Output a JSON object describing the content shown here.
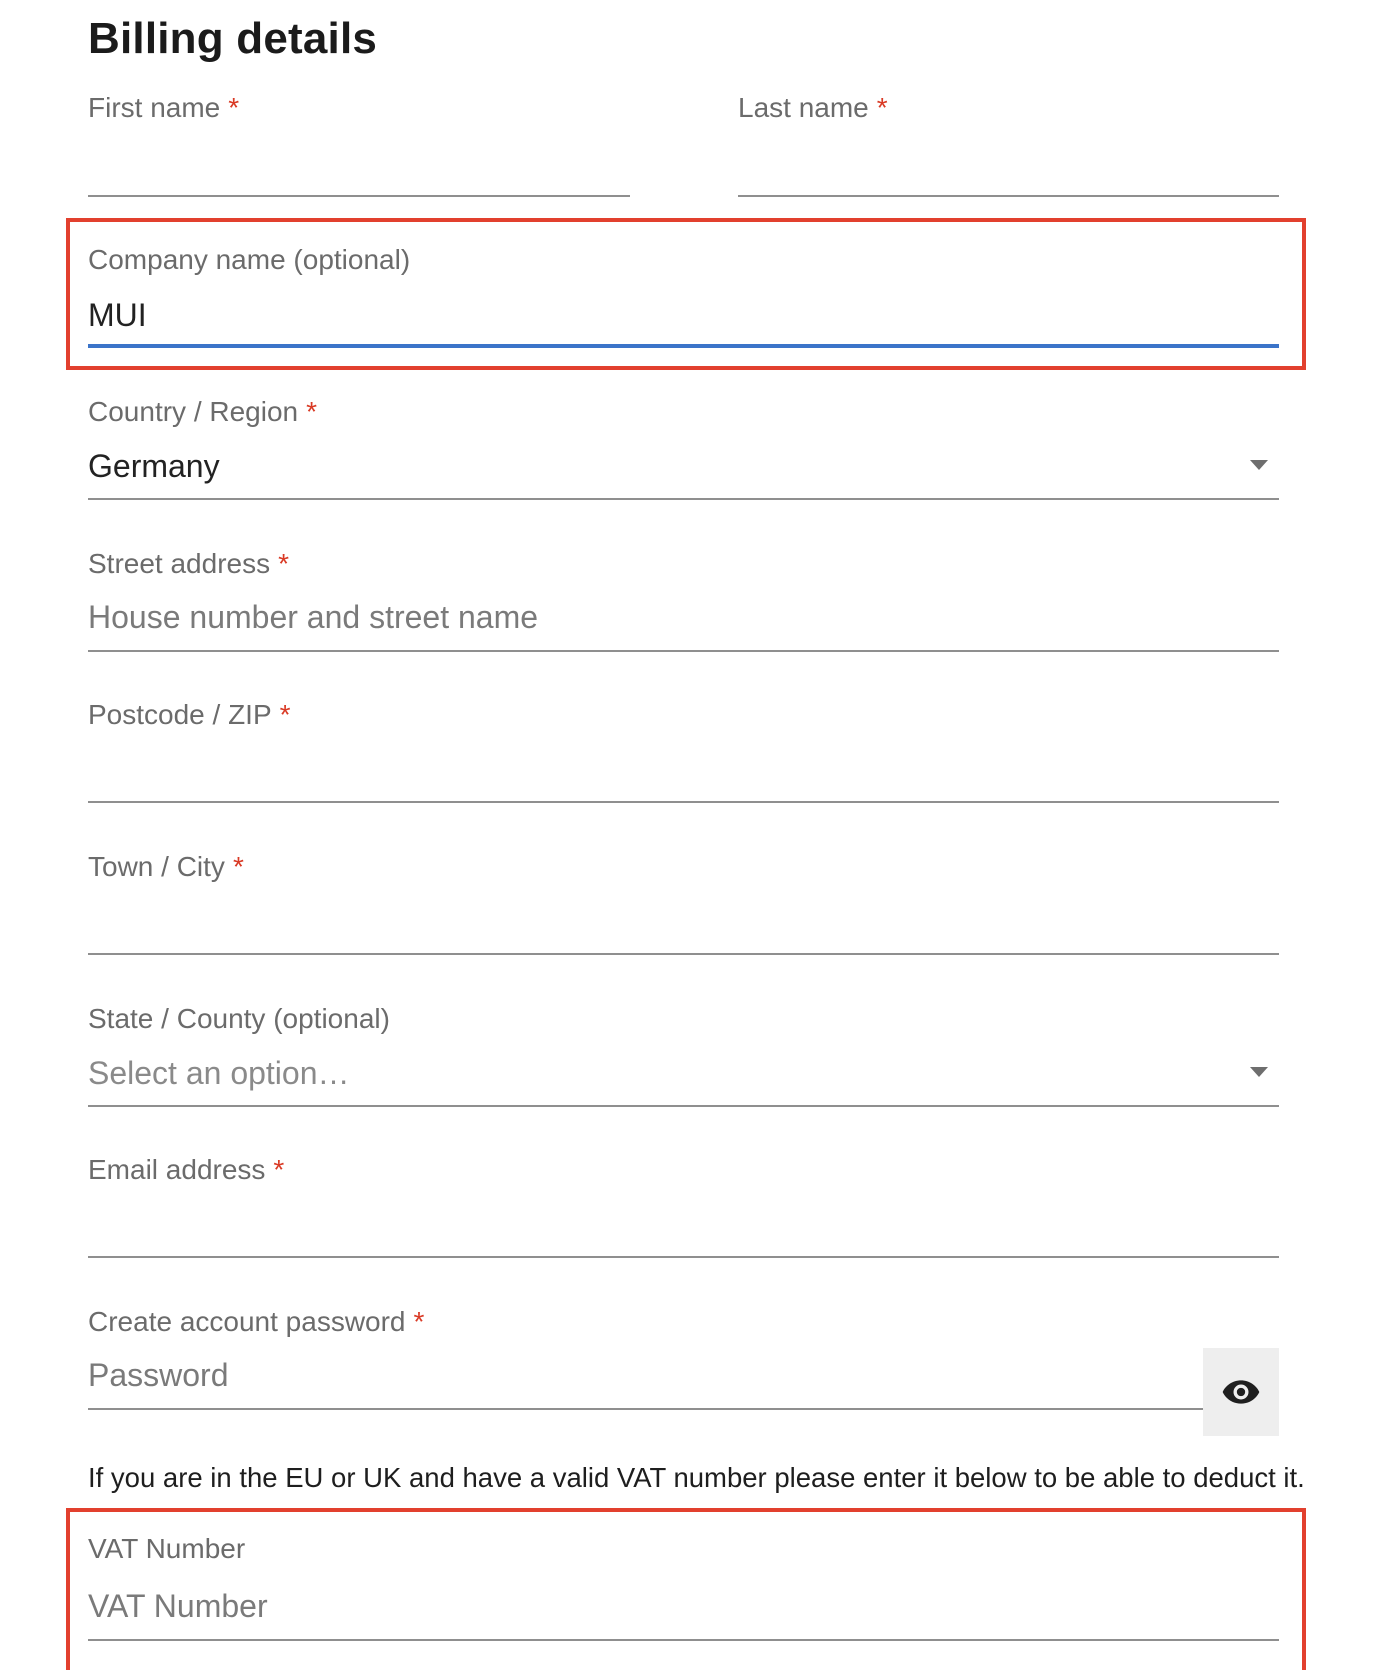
{
  "page": {
    "title": "Billing details"
  },
  "fields": {
    "first_name": {
      "label": "First name",
      "required_mark": "*",
      "value": ""
    },
    "last_name": {
      "label": "Last name",
      "required_mark": "*",
      "value": ""
    },
    "company_name": {
      "label": "Company name (optional)",
      "value": "MUI",
      "focused": true,
      "highlighted": true
    },
    "country": {
      "label": "Country / Region",
      "required_mark": "*",
      "selected": "Germany"
    },
    "street_address": {
      "label": "Street address",
      "required_mark": "*",
      "placeholder": "House number and street name",
      "value": ""
    },
    "postcode": {
      "label": "Postcode / ZIP",
      "required_mark": "*",
      "value": ""
    },
    "town_city": {
      "label": "Town / City",
      "required_mark": "*",
      "value": ""
    },
    "state_county": {
      "label": "State / County (optional)",
      "placeholder": "Select an option…"
    },
    "email": {
      "label": "Email address",
      "required_mark": "*",
      "value": ""
    },
    "password": {
      "label": "Create account password",
      "required_mark": "*",
      "placeholder": "Password",
      "value": "",
      "toggle_icon": "eye-icon"
    },
    "vat_number": {
      "label": "VAT Number",
      "placeholder": "VAT Number",
      "value": "",
      "highlighted": true
    }
  },
  "vat_note": "If you are in the EU or UK and have a valid VAT number please enter it below to be able to deduct it.",
  "colors": {
    "required_asterisk": "#d93a25",
    "focus_underline": "#3b74c9",
    "highlight_border": "#e2402e",
    "label": "#6b6b6b",
    "underline": "#8f8f8f",
    "eye_button_bg": "#eeeeee"
  }
}
